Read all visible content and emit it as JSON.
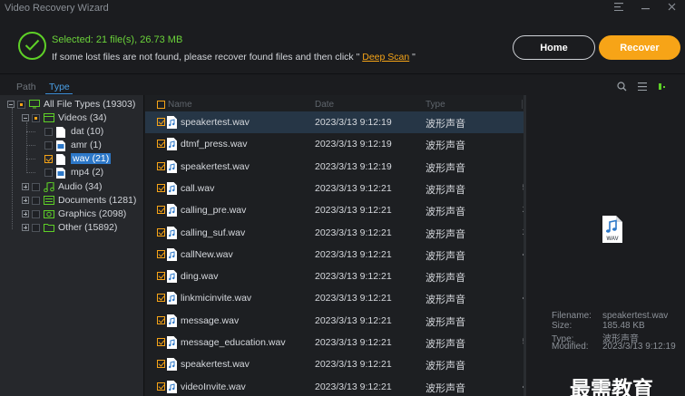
{
  "app": {
    "title": "Video Recovery Wizard"
  },
  "window_controls": [
    "menu-icon",
    "minimize-icon",
    "close-icon"
  ],
  "summary": {
    "selected": "Selected: 21 file(s), 26.73 MB",
    "hint_prefix": "If some lost files are not found, please recover found files and then click \" ",
    "deep_scan": "Deep Scan",
    "hint_suffix": " \""
  },
  "buttons": {
    "home": "Home",
    "recover": "Recover"
  },
  "tabs": [
    "Path",
    "Type"
  ],
  "colors": {
    "accent": "#f7a417",
    "success": "#5ed027",
    "selection": "#2d78c8"
  },
  "tree": [
    {
      "label": "All File Types (19303)"
    },
    {
      "label": "Videos (34)"
    },
    {
      "label": "dat (10)"
    },
    {
      "label": "amr (1)"
    },
    {
      "label": "wav (21)"
    },
    {
      "label": "mp4 (2)"
    },
    {
      "label": "Audio (34)"
    },
    {
      "label": "Documents (1281)"
    },
    {
      "label": "Graphics (2098)"
    },
    {
      "label": "Other (15892)"
    }
  ],
  "list": {
    "headers": [
      "Name",
      "Date",
      "Type"
    ],
    "rows": [
      {
        "name": "speakertest.wav",
        "date": "2023/3/13 9:12:19",
        "type": "波形声音",
        "cut": ""
      },
      {
        "name": "dtmf_press.wav",
        "date": "2023/3/13 9:12:19",
        "type": "波形声音",
        "cut": ""
      },
      {
        "name": "speakertest.wav",
        "date": "2023/3/13 9:12:19",
        "type": "波形声音",
        "cut": ""
      },
      {
        "name": "call.wav",
        "date": "2023/3/13 9:12:21",
        "type": "波形声音",
        "cut": "5"
      },
      {
        "name": "calling_pre.wav",
        "date": "2023/3/13 9:12:21",
        "type": "波形声音",
        "cut": "2"
      },
      {
        "name": "calling_suf.wav",
        "date": "2023/3/13 9:12:21",
        "type": "波形声音",
        "cut": "2"
      },
      {
        "name": "callNew.wav",
        "date": "2023/3/13 9:12:21",
        "type": "波形声音",
        "cut": "4"
      },
      {
        "name": "ding.wav",
        "date": "2023/3/13 9:12:21",
        "type": "波形声音",
        "cut": ""
      },
      {
        "name": "linkmicinvite.wav",
        "date": "2023/3/13 9:12:21",
        "type": "波形声音",
        "cut": "4"
      },
      {
        "name": "message.wav",
        "date": "2023/3/13 9:12:21",
        "type": "波形声音",
        "cut": ""
      },
      {
        "name": "message_education.wav",
        "date": "2023/3/13 9:12:21",
        "type": "波形声音",
        "cut": "5"
      },
      {
        "name": "speakertest.wav",
        "date": "2023/3/13 9:12:21",
        "type": "波形声音",
        "cut": ""
      },
      {
        "name": "videoInvite.wav",
        "date": "2023/3/13 9:12:21",
        "type": "波形声音",
        "cut": "4"
      }
    ]
  },
  "preview": {
    "icon_label": "WAV",
    "filename_key": "Filename:",
    "filename": "speakertest.wav",
    "size_key": "Size:",
    "size": "185.48 KB",
    "type_key": "Type:",
    "type": "波形声音",
    "modified_key": "Modified:",
    "modified": "2023/3/13 9:12:19"
  },
  "watermark": "最需教育"
}
